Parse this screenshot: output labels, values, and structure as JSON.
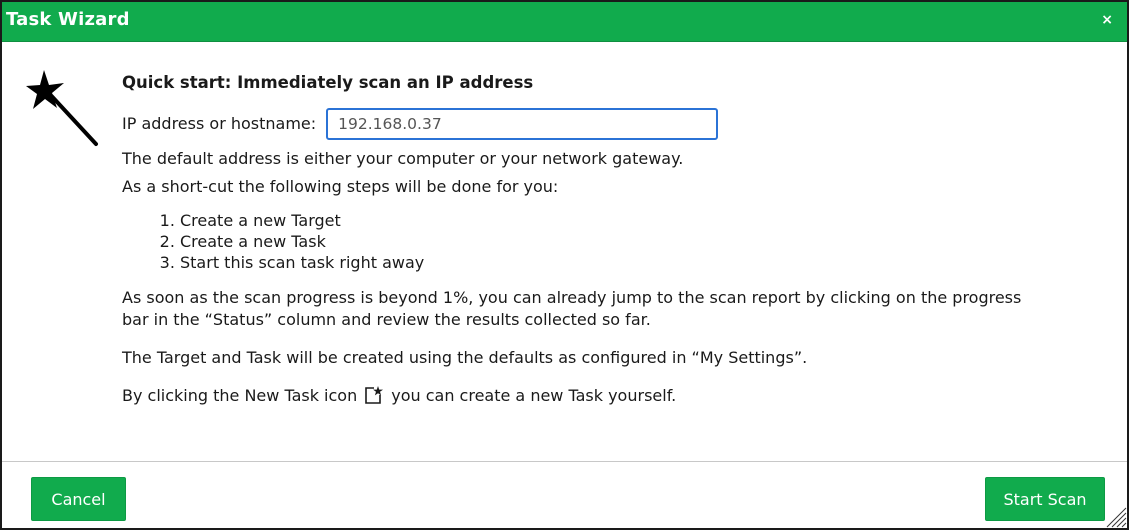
{
  "dialog": {
    "title": "Task Wizard",
    "close_label": "×"
  },
  "content": {
    "heading": "Quick start: Immediately scan an IP address",
    "ip_label": "IP address or hostname:",
    "ip_value": "192.168.0.37",
    "default_note": "The default address is either your computer or your network gateway.",
    "shortcut_intro": "As a short-cut the following steps will be done for you:",
    "steps": [
      "Create a new Target",
      "Create a new Task",
      "Start this scan task right away"
    ],
    "progress_note_1": "As soon as the scan progress is beyond 1%, you can already jump to the scan report by clicking on the progress",
    "progress_note_2": "bar in the “Status” column and review the results collected so far.",
    "defaults_note": "The Target and Task will be created using the defaults as configured in “My Settings”.",
    "newtask_before": "By clicking the New Task icon",
    "newtask_after": "you can create a new Task yourself."
  },
  "footer": {
    "cancel_label": "Cancel",
    "start_label": "Start Scan"
  },
  "colors": {
    "accent": "#11ab4d",
    "input_border": "#2b73d6"
  },
  "icons": {
    "wand": "wizard-wand-icon",
    "new_task": "new-task-icon",
    "close": "close-icon",
    "resize": "resize-grip-icon"
  }
}
